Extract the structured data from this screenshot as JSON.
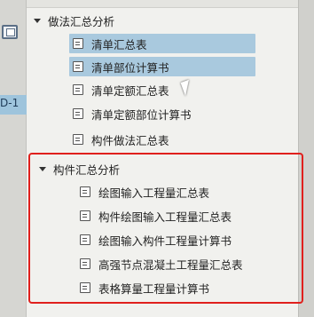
{
  "left_panel": {
    "row_label": "D-1"
  },
  "groups": [
    {
      "title": "做法汇总分析",
      "items": [
        {
          "label": "清单汇总表",
          "selected": true
        },
        {
          "label": "清单部位计算书",
          "selected": true
        },
        {
          "label": "清单定额汇总表",
          "selected": false
        },
        {
          "label": "清单定额部位计算书",
          "selected": false
        },
        {
          "label": "构件做法汇总表",
          "selected": false
        }
      ]
    },
    {
      "title": "构件汇总分析",
      "items": [
        {
          "label": "绘图输入工程量汇总表",
          "selected": false
        },
        {
          "label": "构件绘图输入工程量汇总表",
          "selected": false
        },
        {
          "label": "绘图输入构件工程量计算书",
          "selected": false
        },
        {
          "label": "高强节点混凝土工程量汇总表",
          "selected": false
        },
        {
          "label": "表格算量工程量计算书",
          "selected": false
        }
      ]
    }
  ],
  "colors": {
    "selection": "#a9c9de",
    "highlight_border": "#e0201d"
  }
}
